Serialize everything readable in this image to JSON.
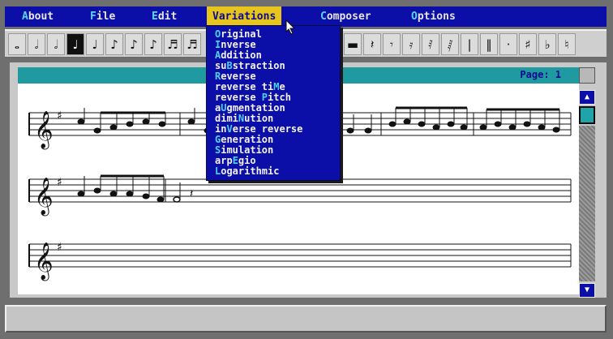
{
  "menu": [
    {
      "pre": "",
      "hk": "A",
      "post": "bout"
    },
    {
      "pre": "",
      "hk": "F",
      "post": "ile"
    },
    {
      "pre": "",
      "hk": "E",
      "post": "dit"
    },
    {
      "pre": "",
      "hk": "V",
      "post": "ariations"
    },
    {
      "pre": "",
      "hk": "C",
      "post": "omposer"
    },
    {
      "pre": "",
      "hk": "O",
      "post": "ptions"
    }
  ],
  "active_menu": "Variations",
  "page_label": "Page: 1",
  "variations": [
    {
      "pre": "",
      "hk": "O",
      "post": "riginal"
    },
    {
      "pre": "",
      "hk": "I",
      "post": "nverse"
    },
    {
      "pre": "",
      "hk": "A",
      "post": "ddition"
    },
    {
      "pre": "su",
      "hk": "B",
      "post": "straction"
    },
    {
      "pre": "",
      "hk": "R",
      "post": "everse"
    },
    {
      "pre": "reverse ti",
      "hk": "M",
      "post": "e"
    },
    {
      "pre": "reverse ",
      "hk": "P",
      "post": "itch"
    },
    {
      "pre": "a",
      "hk": "U",
      "post": "gmentation"
    },
    {
      "pre": "dimi",
      "hk": "N",
      "post": "ution"
    },
    {
      "pre": "in",
      "hk": "V",
      "post": "erse reverse"
    },
    {
      "pre": "",
      "hk": "G",
      "post": "eneration"
    },
    {
      "pre": "",
      "hk": "S",
      "post": "imulation"
    },
    {
      "pre": "arp",
      "hk": "E",
      "post": "gio"
    },
    {
      "pre": "",
      "hk": "L",
      "post": "ogarithmic"
    }
  ],
  "toolbar": {
    "durations": [
      "whole-note",
      "half-note",
      "half-note-stem-up",
      "quarter-note",
      "quarter-note-stem-up",
      "eighth-note",
      "eighth-note-stem-up",
      "sixteenth-note"
    ],
    "selected_duration": "quarter-note",
    "rests": [
      "whole-rest",
      "quarter-rest",
      "eighth-rest",
      "sixteenth-rest",
      "thirty-second-rest",
      "sixty-fourth-rest"
    ],
    "symbols": [
      "barline",
      "dot",
      "sharp",
      "flat",
      "natural"
    ]
  }
}
